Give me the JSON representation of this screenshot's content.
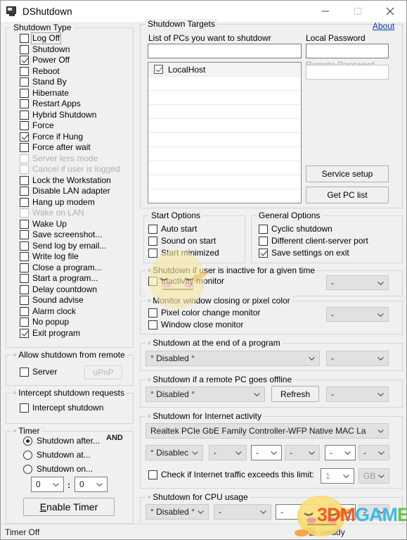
{
  "window": {
    "title": "DShutdown",
    "icon": "monitor-icon",
    "minimize": "minimize-icon",
    "maximize": "maximize-icon",
    "close": "close-icon"
  },
  "shutdown_type": {
    "title": "Shutdown Type",
    "items": [
      {
        "label": "Log Off",
        "checked": false,
        "disabled": false,
        "focused": true
      },
      {
        "label": "Shutdown",
        "checked": false,
        "disabled": false
      },
      {
        "label": "Power Off",
        "checked": true,
        "disabled": false
      },
      {
        "label": "Reboot",
        "checked": false,
        "disabled": false
      },
      {
        "label": "Stand By",
        "checked": false,
        "disabled": false
      },
      {
        "label": "Hibernate",
        "checked": false,
        "disabled": false
      },
      {
        "label": "Restart Apps",
        "checked": false,
        "disabled": false
      },
      {
        "label": "Hybrid Shutdown",
        "checked": false,
        "disabled": false
      },
      {
        "label": "Force",
        "checked": false,
        "disabled": false
      },
      {
        "label": "Force if Hung",
        "checked": true,
        "disabled": false
      },
      {
        "label": "Force after wait",
        "checked": false,
        "disabled": false
      },
      {
        "label": "Server less mode",
        "checked": false,
        "disabled": true
      },
      {
        "label": "Cancel if user is logged",
        "checked": false,
        "disabled": true
      },
      {
        "label": "Lock the Workstation",
        "checked": false,
        "disabled": false
      },
      {
        "label": "Disable LAN adapter",
        "checked": false,
        "disabled": false
      },
      {
        "label": "Hang up modem",
        "checked": false,
        "disabled": false
      },
      {
        "label": "Wake on LAN",
        "checked": false,
        "disabled": true
      },
      {
        "label": "Wake Up",
        "checked": false,
        "disabled": false
      },
      {
        "label": "Save screenshot...",
        "checked": false,
        "disabled": false
      },
      {
        "label": "Send log by email...",
        "checked": false,
        "disabled": false
      },
      {
        "label": "Write log file",
        "checked": false,
        "disabled": false
      },
      {
        "label": "Close a program...",
        "checked": false,
        "disabled": false
      },
      {
        "label": "Start a program...",
        "checked": false,
        "disabled": false
      },
      {
        "label": "Delay countdown",
        "checked": false,
        "disabled": false
      },
      {
        "label": "Sound advise",
        "checked": false,
        "disabled": false
      },
      {
        "label": "Alarm clock",
        "checked": false,
        "disabled": false
      },
      {
        "label": "No popup",
        "checked": false,
        "disabled": false
      },
      {
        "label": "Exit program",
        "checked": true,
        "disabled": false
      }
    ]
  },
  "allow_remote": {
    "title": "Allow shutdown from remote",
    "server_label": "Server",
    "server_checked": false,
    "upnp_label": "uPnP",
    "upnp_disabled": true
  },
  "intercept": {
    "title": "Intercept shutdown requests",
    "checkbox_label": "Intercept shutdown",
    "checked": false
  },
  "timer": {
    "title": "Timer",
    "and_label": "AND",
    "options": [
      {
        "label": "Shutdown after...",
        "selected": true
      },
      {
        "label": "Shutdown at...",
        "selected": false
      },
      {
        "label": "Shutdown on...",
        "selected": false
      }
    ],
    "hours": "0",
    "separator": ":",
    "minutes": "0",
    "button_label_prefix": "E",
    "button_label_rest": "nable Timer"
  },
  "targets": {
    "title": "Shutdown Targets",
    "about_link": "About",
    "pc_list_label": "List of PCs you want to shutdowr",
    "pc_name_value": "",
    "pc_name_placeholder": "",
    "local_password_label": "Local Password",
    "local_password_value": "",
    "remote_password_label": "Remote Password",
    "remote_password_value": "",
    "list_rows": [
      {
        "label": "LocalHost",
        "checked": true
      }
    ],
    "empty_rows": 9,
    "service_setup_button": "Service setup",
    "get_pc_list_button": "Get PC list"
  },
  "start_options": {
    "title": "Start Options",
    "items": [
      {
        "label": "Auto start",
        "checked": false
      },
      {
        "label": "Sound on start",
        "checked": false
      },
      {
        "label": "Start minimized",
        "checked": false
      }
    ]
  },
  "general_options": {
    "title": "General Options",
    "items": [
      {
        "label": "Cyclic shutdown",
        "checked": false
      },
      {
        "label": "Different client-server port",
        "checked": false
      },
      {
        "label": "Save settings on exit",
        "checked": true
      }
    ]
  },
  "inactivity": {
    "title": "Shutdown if user is inactive for a given time",
    "checkbox_label": "Inactivity monitor",
    "checked": false,
    "combo_value": "-"
  },
  "monitor_window": {
    "title": "Monitor window closing or pixel color",
    "items": [
      {
        "label": "Pixel color change monitor",
        "checked": false
      },
      {
        "label": "Window close monitor",
        "checked": false
      }
    ],
    "combo_value": "-"
  },
  "end_of_program": {
    "title": "Shutdown at the end of a program",
    "combo_main": "° Disabled °",
    "combo_side": "-"
  },
  "remote_offline": {
    "title": "Shutdown if a remote PC goes offline",
    "combo_main": "° Disabled °",
    "refresh_button": "Refresh",
    "combo_side": "-"
  },
  "internet_activity": {
    "title": "Shutdown for Internet activity",
    "adapter": "Realtek PCIe GbE Family Controller-WFP Native MAC La",
    "combos": [
      {
        "value": "° Disablec",
        "style": "gray"
      },
      {
        "value": "-",
        "style": "gray"
      },
      {
        "value": "-",
        "style": "white"
      },
      {
        "value": "-",
        "style": "gray"
      },
      {
        "value": "-",
        "style": "white"
      },
      {
        "value": "-",
        "style": "gray"
      }
    ],
    "limit_label": "Check if Internet traffic exceeds this limit:",
    "limit_checked": false,
    "limit_value": "1",
    "limit_unit": "GB"
  },
  "cpu_usage": {
    "title": "Shutdown for CPU usage",
    "combos": [
      {
        "value": "° Disabled °",
        "style": "gray"
      },
      {
        "value": "-",
        "style": "gray"
      },
      {
        "value": "-",
        "style": "white"
      },
      {
        "value": "-",
        "style": "white"
      },
      {
        "value": "-",
        "style": "gray"
      }
    ]
  },
  "statusbar": {
    "left": "Timer Off",
    "right": "Ready",
    "icon": "monitor-small-icon"
  },
  "watermark": {
    "logo_part1": "3DM",
    "logo_part2": "GAM",
    "logo_part3": "E",
    "mascot": "chick-mascot"
  },
  "colors": {
    "accent_link": "#0b3fa8",
    "window_bg": "#f0f0f0",
    "logo_orange": "#f05a28",
    "logo_cyan": "#3fb9e2",
    "logo_green": "#6cc24a"
  }
}
